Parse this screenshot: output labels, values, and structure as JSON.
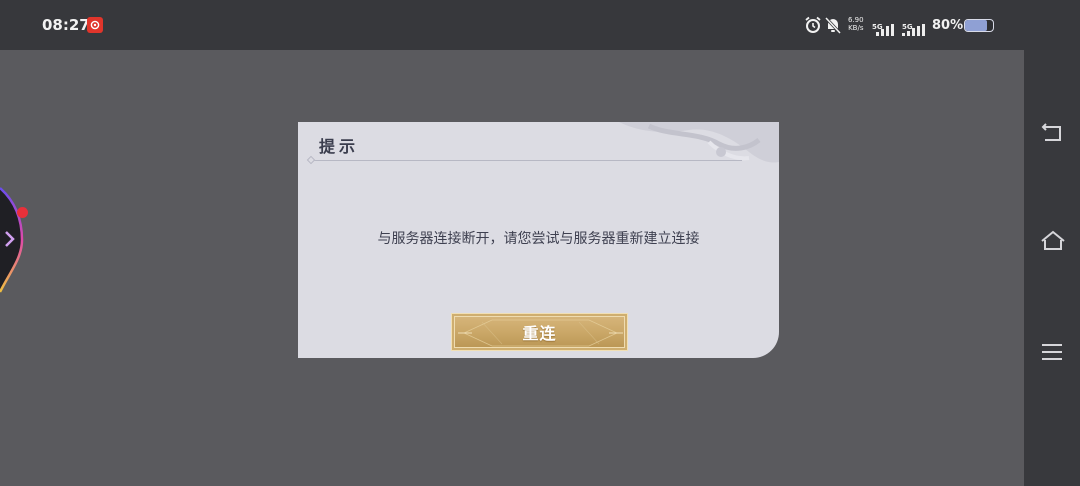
{
  "status_bar": {
    "time": "08:27",
    "network_speed_value": "6.90",
    "network_speed_unit": "KB/s",
    "sim1_label": "5G",
    "sim2_label": "5G",
    "battery_percent": "80%",
    "battery_level": 0.8,
    "icons": [
      "app-notification-icon",
      "alarm-icon",
      "mute-icon",
      "signal-icon",
      "signal-icon",
      "battery-icon"
    ]
  },
  "dialog": {
    "title": "提示",
    "message": "与服务器连接断开，请您尝试与服务器重新建立连接",
    "button_label": "重连"
  },
  "nav_bar": {
    "buttons": [
      "back-icon",
      "home-icon",
      "menu-icon"
    ]
  },
  "colors": {
    "background": "#5a5a5e",
    "status_bar": "#37383c",
    "dialog_bg": "#dcdce3",
    "button_gold": "#c9a666",
    "notification_red": "#e0352b",
    "float_dot_red": "#e8303a"
  }
}
